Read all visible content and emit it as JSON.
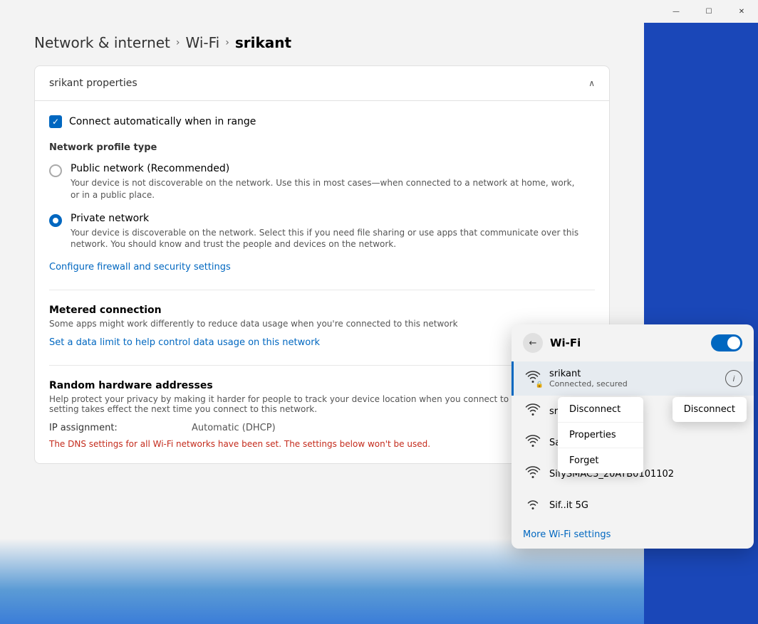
{
  "titlebar": {
    "minimize_label": "—",
    "maximize_label": "☐",
    "close_label": "✕"
  },
  "breadcrumb": {
    "link1": "Network & internet",
    "sep1": "›",
    "link2": "Wi-Fi",
    "sep2": "›",
    "current": "srikant"
  },
  "card": {
    "header_title": "srikant properties",
    "chevron": "∧"
  },
  "checkbox": {
    "label": "Connect automatically when in range",
    "checked": true
  },
  "network_profile": {
    "section_label": "Network profile type",
    "public": {
      "title": "Public network (Recommended)",
      "desc": "Your device is not discoverable on the network. Use this in most cases—when connected to a network at home, work, or in a public place."
    },
    "private": {
      "title": "Private network",
      "desc": "Your device is discoverable on the network. Select this if you need file sharing or use apps that communicate over this network. You should know and trust the people and devices on the network."
    }
  },
  "firewall_link": "Configure firewall and security settings",
  "metered": {
    "title": "Metered connection",
    "desc": "Some apps might work differently to reduce data usage when you're connected to this network",
    "link": "Set a data limit to help control data usage on this network"
  },
  "random_hw": {
    "title": "Random hardware addresses",
    "desc": "Help protect your privacy by making it harder for people to track your device location when you connect to this network. The setting takes effect the next time you connect to this network."
  },
  "ip": {
    "key": "IP assignment:",
    "value": "Automatic (DHCP)"
  },
  "dns_warning": "The DNS settings for all Wi-Fi networks have been set. The settings below won't be used.",
  "wifi_flyout": {
    "title": "Wi-Fi",
    "back_icon": "←",
    "toggle_on": true,
    "networks": [
      {
        "name": "srikant",
        "status": "Connected, secured",
        "active": true
      },
      {
        "name": "sri",
        "status": "",
        "active": false
      },
      {
        "name": "Satyajit",
        "status": "",
        "active": false
      },
      {
        "name": "SifySMAC3_20ATB0101102",
        "status": "",
        "active": false
      },
      {
        "name": "Sif..it 5G",
        "status": "",
        "active": false
      }
    ],
    "context_menu": {
      "items": [
        "Disconnect",
        "Properties",
        "Forget"
      ]
    },
    "disconnect_button": "Disconnect",
    "more_settings": "More Wi-Fi settings"
  }
}
